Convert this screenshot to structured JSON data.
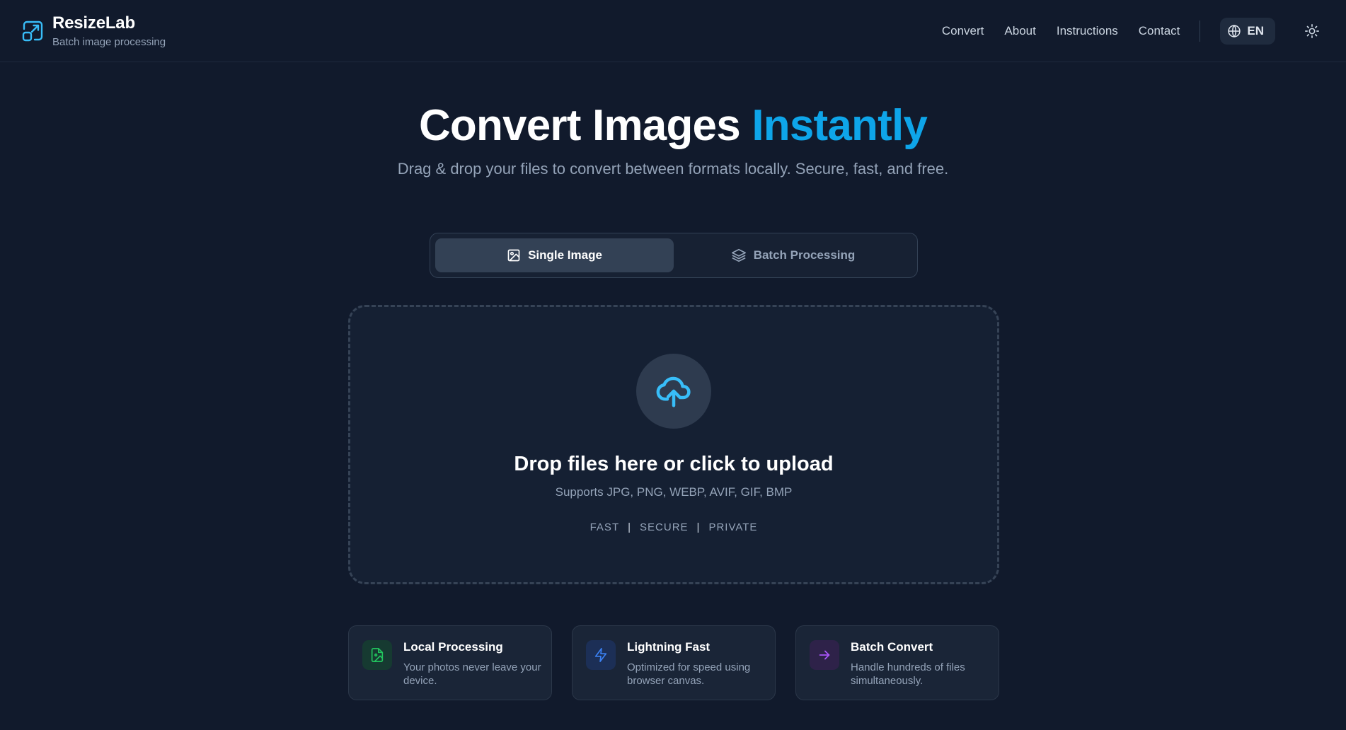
{
  "header": {
    "brand_name": "ResizeLab",
    "brand_tagline": "Batch image processing",
    "nav": [
      "Convert",
      "About",
      "Instructions",
      "Contact"
    ],
    "language": "EN"
  },
  "hero": {
    "title_main": "Convert Images",
    "title_accent": "Instantly",
    "subtitle": "Drag & drop your files to convert between formats locally. Secure, fast, and free."
  },
  "mode_toggle": {
    "single_label": "Single Image",
    "batch_label": "Batch Processing",
    "active": "single"
  },
  "dropzone": {
    "title": "Drop files here or click to upload",
    "formats": "Supports JPG, PNG, WEBP, AVIF, GIF, BMP",
    "badges": [
      "FAST",
      "SECURE",
      "PRIVATE"
    ],
    "separator": "|"
  },
  "features": [
    {
      "title": "Local Processing",
      "desc": "Your photos never leave your device.",
      "icon": "image-file-icon",
      "color": "#22c55e"
    },
    {
      "title": "Lightning Fast",
      "desc": "Optimized for speed using browser canvas.",
      "icon": "lightning-icon",
      "color": "#3b82f6"
    },
    {
      "title": "Batch Convert",
      "desc": "Handle hundreds of files simultaneously.",
      "icon": "arrow-right-icon",
      "color": "#a855f7"
    }
  ],
  "colors": {
    "background": "#111a2c",
    "accent": "#0ea5e9",
    "surface": "#152033"
  }
}
